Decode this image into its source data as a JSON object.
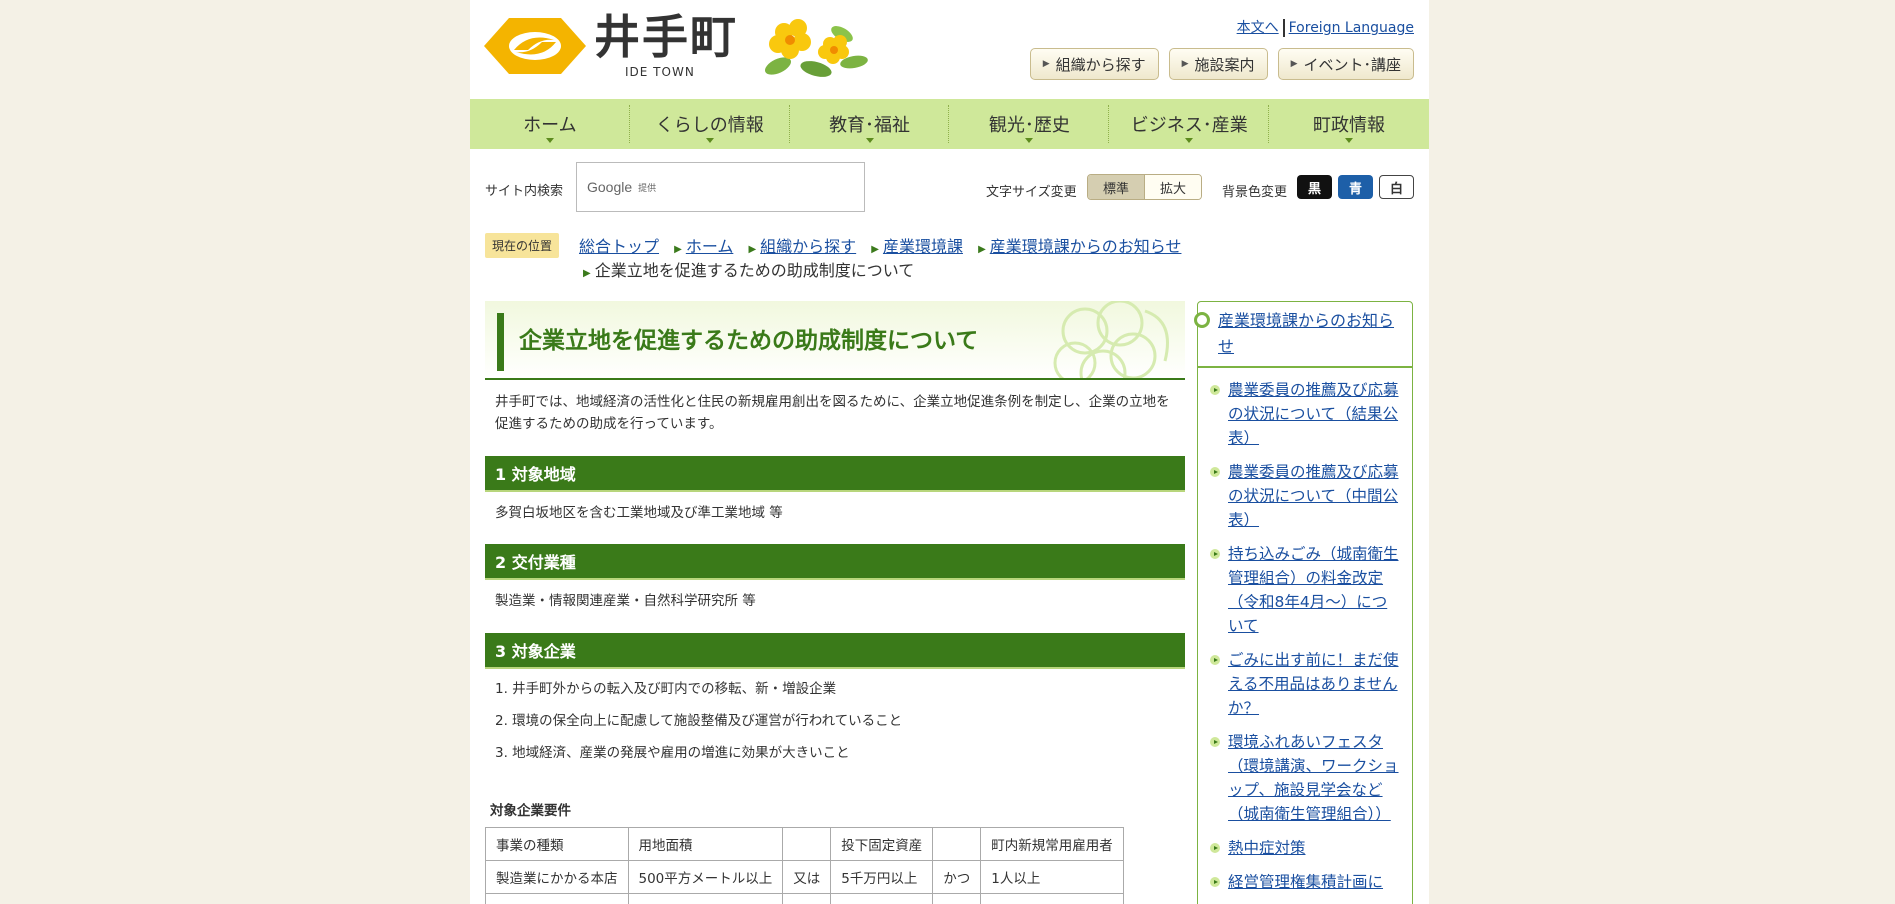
{
  "header": {
    "logo_text": "井手町",
    "logo_sub": "IDE TOWN",
    "top_links": [
      "本文へ",
      "Foreign Language"
    ],
    "buttons": [
      "組織から探す",
      "施設案内",
      "イベント･講座"
    ]
  },
  "gnav": [
    "ホーム",
    "くらしの情報",
    "教育･福祉",
    "観光･歴史",
    "ビジネス･産業",
    "町政情報"
  ],
  "tools": {
    "search_label": "サイト内検索",
    "search_google": "Google",
    "search_provided": "提供",
    "font_size_label": "文字サイズ変更",
    "font_standard": "標準",
    "font_large": "拡大",
    "bg_label": "背景色変更",
    "bg_black": "黒",
    "bg_blue": "青",
    "bg_white": "白"
  },
  "breadcrumb": {
    "here": "現在の位置",
    "items": [
      "総合トップ",
      "ホーム",
      "組織から探す",
      "産業環境課",
      "産業環境課からのお知らせ"
    ],
    "current": "企業立地を促進するための助成制度について"
  },
  "main": {
    "title": "企業立地を促進するための助成制度について",
    "lead": "井手町では、地域経済の活性化と住民の新規雇用創出を図るために、企業立地促進条例を制定し、企業の立地を促進するための助成を行っています。",
    "sections": [
      {
        "heading": "1 対象地域",
        "text": "多賀白坂地区を含む工業地域及び準工業地域 等"
      },
      {
        "heading": "2 交付業種",
        "text": "製造業・情報関連産業・自然科学研究所 等"
      },
      {
        "heading": "3 対象企業"
      }
    ],
    "list": [
      "1. 井手町外からの転入及び町内での移転、新・増設企業",
      "2. 環境の保全向上に配慮して施設整備及び運営が行われていること",
      "3. 地域経済、産業の発展や雇用の増進に効果が大きいこと"
    ],
    "req_title": "対象企業要件",
    "table": {
      "header": [
        "事業の種類",
        "用地面積",
        "",
        "投下固定資産",
        "",
        "町内新規常用雇用者"
      ],
      "rows": [
        [
          "製造業にかかる本店",
          "500平方メートル以上",
          "又は",
          "5千万円以上",
          "かつ",
          "1人以上"
        ]
      ]
    }
  },
  "sidebar": {
    "title": "産業環境課からのお知らせ",
    "items": [
      "農業委員の推薦及び応募の状況について（結果公表）",
      "農業委員の推薦及び応募の状況について（中間公表）",
      "持ち込みごみ（城南衛生管理組合）の料金改定（令和8年4月～）について",
      "ごみに出す前に！まだ使える不用品はありませんか？",
      "環境ふれあいフェスタ（環境講演、ワークショップ、施設見学会など（城南衛生管理組合））",
      "熱中症対策",
      "経営管理権集積計画に"
    ]
  }
}
